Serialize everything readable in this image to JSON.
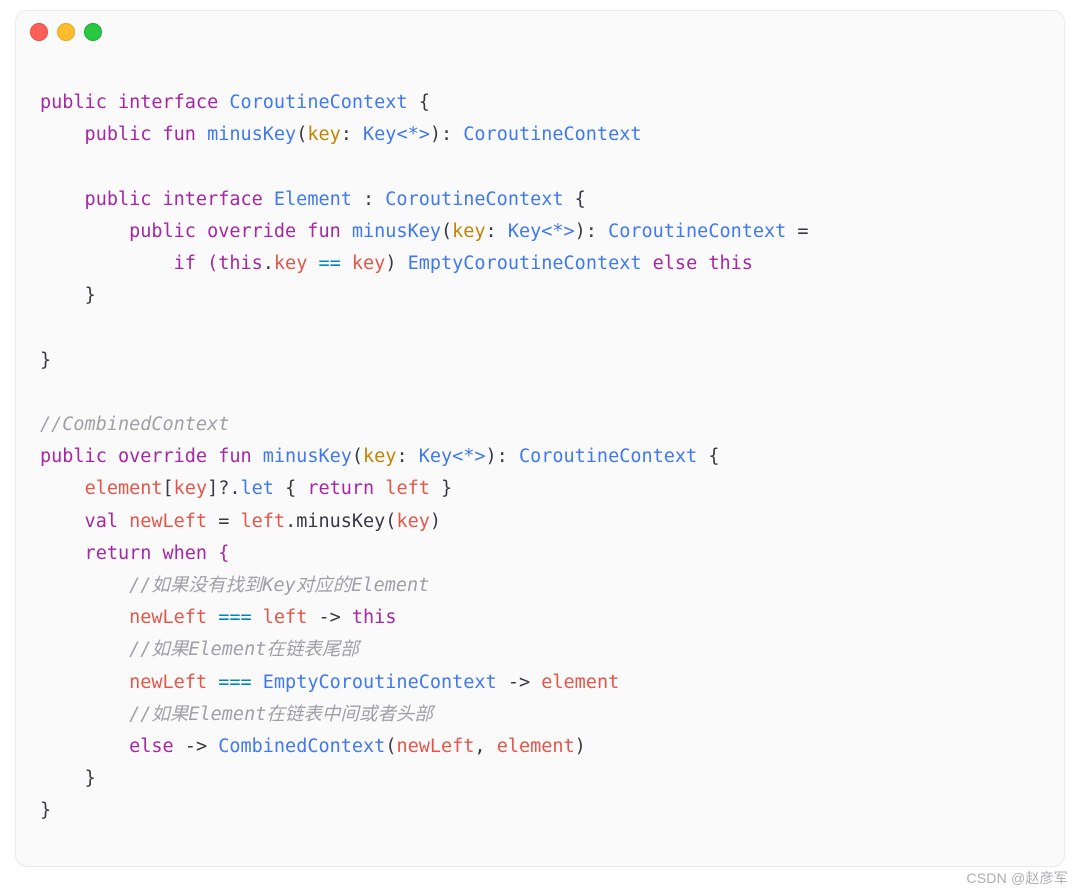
{
  "window": {
    "dots": [
      "red",
      "yellow",
      "green"
    ]
  },
  "code": {
    "decl_iface": "public interface ",
    "iface_name": "CoroutineContext",
    "obr": " {",
    "cbr": "}",
    "fun_minus_sig1a": "    public fun ",
    "fun_minus_name": "minusKey",
    "fun_minus_sig1b": "(",
    "param_key": "key",
    "colon_sp": ": ",
    "type_keystar": "Key<*>",
    "paren_close_colon": "): ",
    "ret_type": "CoroutineContext",
    "elem_iface_a": "    public interface ",
    "elem_iface_name": "Element",
    "elem_extends": " : ",
    "elem_iface_obr": " {",
    "elem_fun_a": "        public override fun ",
    "elem_fun_eq": " =",
    "elem_body_a": "            if (",
    "this_kw": "this",
    "dot": ".",
    "prop_key": "key",
    "eqeq": " == ",
    "paren_close_sp": ") ",
    "empty_ctx": "EmptyCoroutineContext",
    "else_kw": " else ",
    "comb_comment": "//CombinedContext",
    "comb_fun_a": "public override fun ",
    "comb_obr": " {",
    "comb_l1a": "    ",
    "element_word": "element",
    "bracket_open": "[",
    "bracket_close": "]",
    "qdot": "?.",
    "let_word": "let",
    "sp_obr": " { ",
    "return_kw": "return",
    "sp": " ",
    "left_word": "left",
    "sp_cbr": " }",
    "comb_l2": "    val ",
    "newLeft": "newLeft",
    "assign": " = ",
    "dot_minus": ".minusKey(",
    "paren_close": ")",
    "return_when": "    return when {",
    "cmt1": "        //如果没有找到Key对应的Element",
    "when1a": "        ",
    "eqeqeq": " === ",
    "arrow": " -> ",
    "cmt2": "        //如果Element在链表尾部",
    "cmt3": "        //如果Element在链表中间或者头部",
    "else_only": "else",
    "CombinedContext": "CombinedContext",
    "comma_sp": ", "
  },
  "watermark": "CSDN @赵彦军"
}
